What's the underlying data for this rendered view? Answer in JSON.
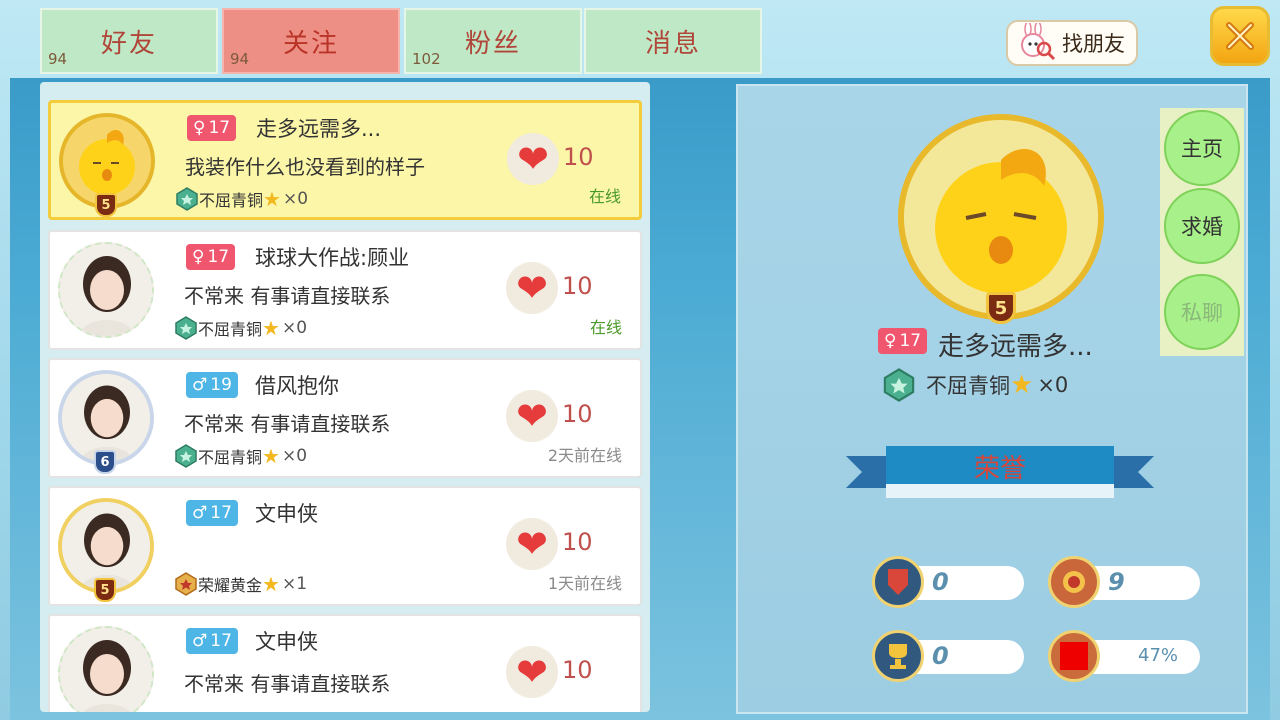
{
  "tabs": [
    {
      "label": "好友",
      "count": "94"
    },
    {
      "label": "关注",
      "count": "94"
    },
    {
      "label": "粉丝",
      "count": "102"
    },
    {
      "label": "消息",
      "count": ""
    }
  ],
  "find_friends_label": "找朋友",
  "friends": [
    {
      "gender": "female",
      "age": "17",
      "name": "走多远需多...",
      "signature": "我装作什么也没看到的样子",
      "rank": "不屈青铜",
      "stars": "×0",
      "likes": "10",
      "status": "在线",
      "level": "5"
    },
    {
      "gender": "female",
      "age": "17",
      "name": "球球大作战:顾业",
      "signature": "不常来 有事请直接联系",
      "rank": "不屈青铜",
      "stars": "×0",
      "likes": "10",
      "status": "在线",
      "level": ""
    },
    {
      "gender": "male",
      "age": "19",
      "name": "借风抱你",
      "signature": "不常来 有事请直接联系",
      "rank": "不屈青铜",
      "stars": "×0",
      "likes": "10",
      "status": "2天前在线",
      "level": "6"
    },
    {
      "gender": "male",
      "age": "17",
      "name": "文申侠",
      "signature": "",
      "rank": "荣耀黄金",
      "stars": "×1",
      "likes": "10",
      "status": "1天前在线",
      "level": "5"
    },
    {
      "gender": "male",
      "age": "17",
      "name": "文申侠",
      "signature": "不常来 有事请直接联系",
      "rank": "",
      "stars": "",
      "likes": "10",
      "status": "",
      "level": ""
    }
  ],
  "detail": {
    "gender": "female",
    "age": "17",
    "name": "走多远需多...",
    "rank": "不屈青铜",
    "stars": "×0",
    "level": "5",
    "buttons": [
      "主页",
      "求婚",
      "私聊"
    ],
    "honor_title": "荣誉",
    "stats": [
      {
        "icon": "flag-icon",
        "value": "0"
      },
      {
        "icon": "medal-icon",
        "value": "9"
      },
      {
        "icon": "trophy-icon",
        "value": "0"
      },
      {
        "icon": "badge-icon",
        "value": "47%"
      }
    ]
  },
  "colors": {
    "tab_bg": "#bfe9c6",
    "tab_active_bg": "#ee8f85",
    "female_badge": "#f0566e",
    "male_badge": "#4eb6e6",
    "selected_row": "#fbf6a8",
    "close_button": "#f3a512"
  }
}
